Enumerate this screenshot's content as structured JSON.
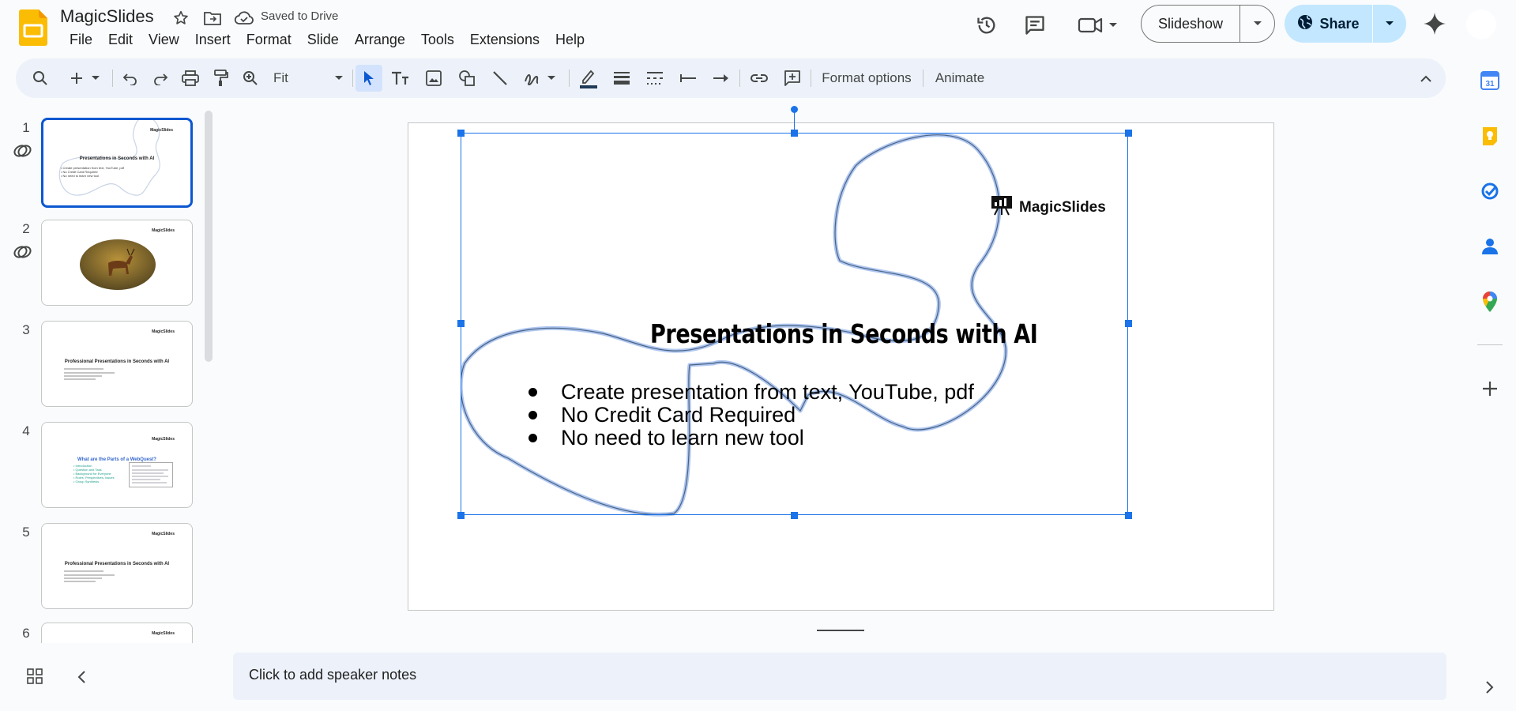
{
  "header": {
    "doc_title": "MagicSlides",
    "save_status": "Saved to Drive",
    "menu": [
      "File",
      "Edit",
      "View",
      "Insert",
      "Format",
      "Slide",
      "Arrange",
      "Tools",
      "Extensions",
      "Help"
    ],
    "slideshow_label": "Slideshow",
    "share_label": "Share"
  },
  "toolbar": {
    "zoom_label": "Fit",
    "format_options_label": "Format options",
    "animate_label": "Animate"
  },
  "filmstrip": {
    "slides": [
      {
        "number": "1",
        "brand": "MagicSlides",
        "title": "Presentations in Seconds with AI",
        "bullets": [
          "Create presentation from text, YouTube, pdf",
          "No Credit Card Required",
          "No need to learn new tool"
        ]
      },
      {
        "number": "2",
        "brand": "MagicSlides"
      },
      {
        "number": "3",
        "brand": "MagicSlides",
        "title": "Professional Presentations in Seconds with AI"
      },
      {
        "number": "4",
        "brand": "MagicSlides",
        "title": "What are the Parts of a WebQuest?",
        "bullets": [
          "Introduction",
          "Question and Task",
          "Background for Everyone",
          "Roles, Perspectives, Issues",
          "Group Synthesis"
        ]
      },
      {
        "number": "5",
        "brand": "MagicSlides",
        "title": "Professional Presentations in Seconds with AI"
      },
      {
        "number": "6",
        "brand": "MagicSlides"
      }
    ]
  },
  "slide": {
    "brand": "MagicSlides",
    "title": "Presentations in Seconds with AI",
    "bullets": [
      "Create presentation from text, YouTube, pdf",
      "No Credit Card Required",
      "No need to learn new tool"
    ]
  },
  "notes": {
    "placeholder": "Click to add speaker notes"
  },
  "colors": {
    "accent": "#0b57d0",
    "selection": "#1a73e8",
    "share_bg": "#c2e7ff",
    "app_yellow": "#fbbc04"
  },
  "icons": [
    "star-icon",
    "move-to-folder-icon",
    "cloud-saved-icon",
    "history-icon",
    "comments-icon",
    "meet-icon",
    "globe-icon",
    "gemini-icon",
    "search-icon",
    "undo-icon",
    "redo-icon",
    "print-icon",
    "paint-format-icon",
    "zoom-icon",
    "cursor-icon",
    "textbox-icon",
    "image-icon",
    "shape-icon",
    "line-icon",
    "scribble-icon",
    "border-color-icon",
    "border-weight-icon",
    "border-dash-icon",
    "line-start-icon",
    "line-end-icon",
    "link-icon",
    "add-comment-icon",
    "calendar-icon",
    "keep-icon",
    "tasks-icon",
    "contacts-icon",
    "maps-icon",
    "plus-icon"
  ]
}
